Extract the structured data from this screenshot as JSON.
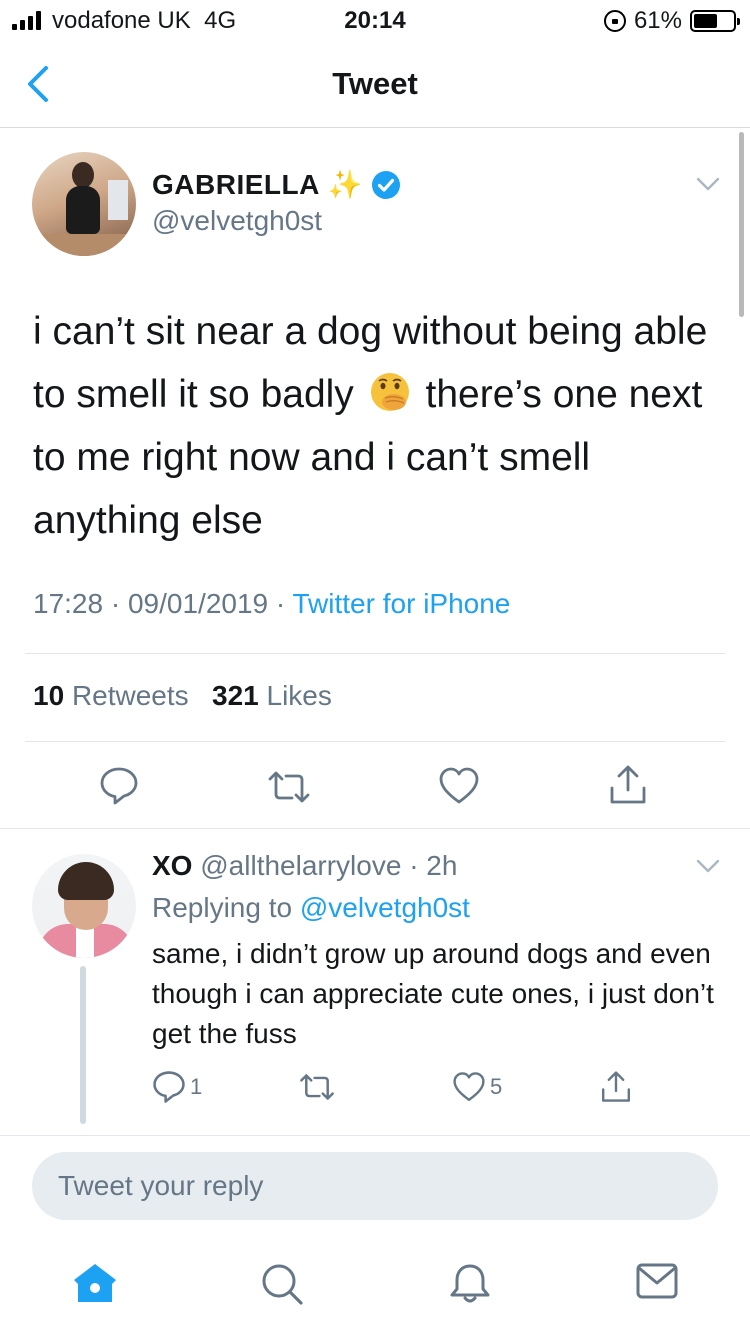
{
  "status_bar": {
    "carrier": "vodafone UK",
    "network": "4G",
    "time": "20:14",
    "battery_percent": "61%",
    "battery_level": 0.61
  },
  "nav": {
    "title": "Tweet",
    "back_icon": "chevron-left-icon"
  },
  "tweet": {
    "author_name": "GABRIELLA",
    "author_decoration": "✨",
    "verified": true,
    "handle": "@velvetgh0st",
    "text_before_emoji": "i can’t sit near a dog without being able to smell it so badly",
    "emoji": "face-with-hand-over-mouth",
    "text_after_emoji": "there’s one next to me right now and i can’t smell anything else",
    "time": "17:28",
    "date": "09/01/2019",
    "separator": "·",
    "source": "Twitter for iPhone",
    "retweets_count": "10",
    "retweets_label": "Retweets",
    "likes_count": "321",
    "likes_label": "Likes"
  },
  "reply": {
    "name": "XO",
    "handle": "@allthelarrylove",
    "age": "· 2h",
    "replying_prefix": "Replying to",
    "replying_to": "@velvetgh0st",
    "text": "same, i didn’t grow up around dogs and even though i can appreciate cute ones, i just don’t get the fuss",
    "reply_count": "1",
    "retweet_count": "",
    "like_count": "5"
  },
  "composer": {
    "placeholder": "Tweet your reply"
  },
  "tabs": [
    "home-icon",
    "search-icon",
    "notifications-icon",
    "messages-icon"
  ],
  "colors": {
    "accent": "#1da1f2",
    "secondary_text": "#657786",
    "divider": "#e1e8ed"
  }
}
